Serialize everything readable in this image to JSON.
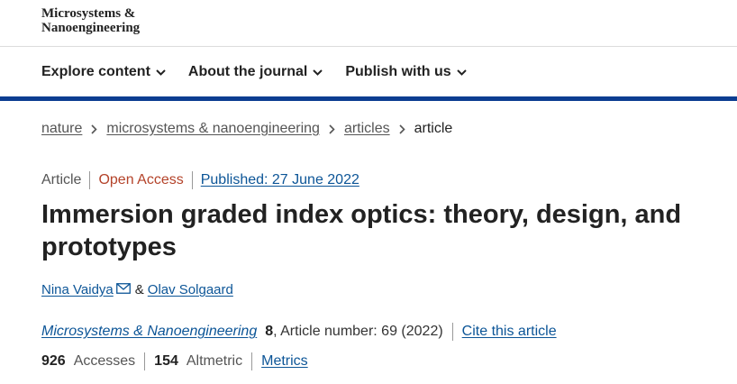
{
  "brand": {
    "line1": "Microsystems &",
    "line2": "Nanoengineering"
  },
  "nav": {
    "items": [
      {
        "label": "Explore content"
      },
      {
        "label": "About the journal"
      },
      {
        "label": "Publish with us"
      }
    ]
  },
  "breadcrumb": {
    "items": [
      "nature",
      "microsystems & nanoengineering",
      "articles"
    ],
    "current": "article"
  },
  "meta": {
    "type": "Article",
    "access": "Open Access",
    "published": "Published: 27 June 2022"
  },
  "title": "Immersion graded index optics: theory, design, and prototypes",
  "authors": {
    "first": "Nina Vaidya",
    "amp": "&",
    "second": "Olav Solgaard"
  },
  "journal": {
    "name": "Microsystems & Nanoengineering",
    "volume": "8",
    "article_info": ", Article number: 69 (2022)",
    "cite": "Cite this article"
  },
  "metrics": {
    "accesses_count": "926",
    "accesses_label": "Accesses",
    "altmetric_count": "154",
    "altmetric_label": "Altmetric",
    "link": "Metrics"
  },
  "colors": {
    "brand_blue": "#0c3d91",
    "link": "#0c5597",
    "open_access": "#b4432a"
  }
}
